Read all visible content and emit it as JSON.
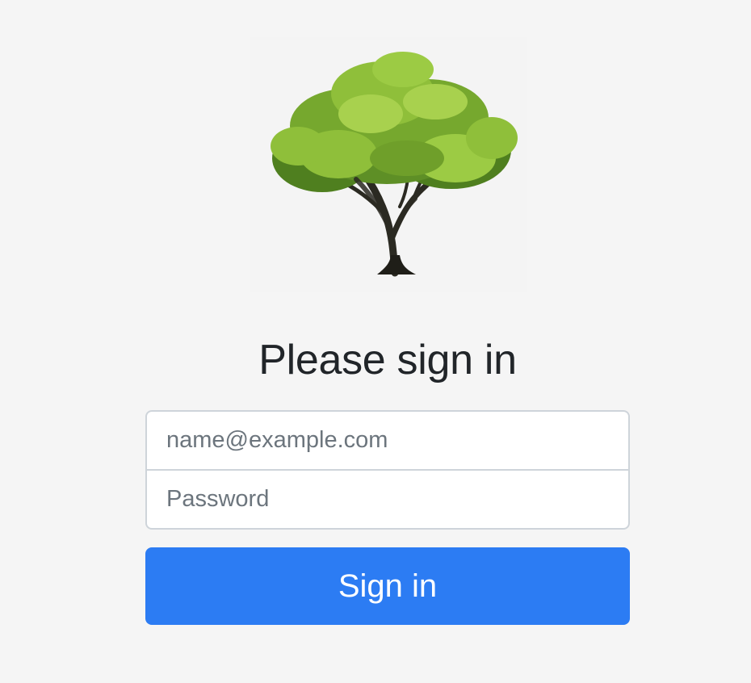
{
  "logo": {
    "icon": "tree-icon",
    "colors": {
      "foliage": "#8fbf3a",
      "foliage_dark": "#4f7f1f",
      "trunk": "#2b2a22"
    }
  },
  "form": {
    "title": "Please sign in",
    "email": {
      "placeholder": "name@example.com",
      "value": ""
    },
    "password": {
      "placeholder": "Password",
      "value": ""
    },
    "submit_label": "Sign in"
  },
  "colors": {
    "background": "#f5f5f5",
    "primary": "#2c7cf3",
    "text": "#212529",
    "placeholder": "#6c757d",
    "border": "#ced4da"
  }
}
